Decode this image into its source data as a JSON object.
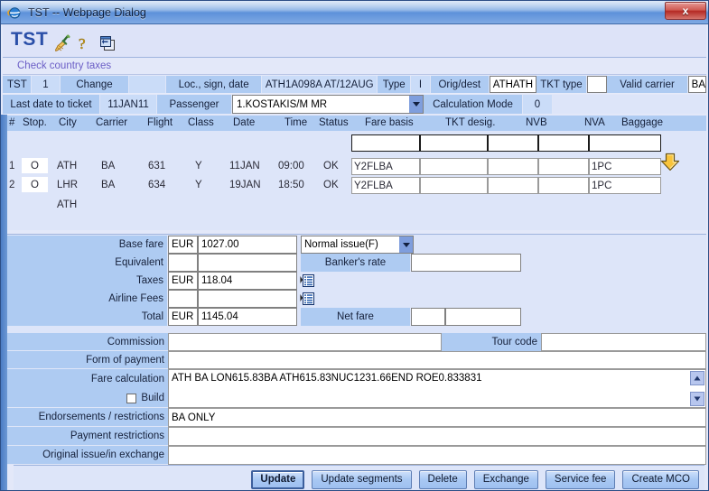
{
  "window": {
    "title": "TST -- Webpage Dialog",
    "close_label": "x",
    "icon": "ie-icon"
  },
  "app": {
    "logo": "TST",
    "toolbar_icons": [
      "broom-icon",
      "help-question-icon",
      "copy-window-icon"
    ],
    "link_check_country_taxes": "Check country taxes"
  },
  "header_row1": {
    "tst_label": "TST",
    "tst_value": "1",
    "change_label": "Change",
    "change_value": "",
    "loc_sign_date_label": "Loc., sign, date",
    "loc_sign_date_value": "ATH1A098A AT/12AUG",
    "type_label": "Type",
    "type_value": "I",
    "orig_dest_label": "Orig/dest",
    "orig_dest_value": "ATHATH",
    "tkt_type_label": "TKT type",
    "tkt_type_value": "",
    "valid_carrier_label": "Valid carrier",
    "valid_carrier_value": "BA"
  },
  "header_row2": {
    "last_date_label": "Last date to ticket",
    "last_date_value": "11JAN11",
    "passenger_label": "Passenger",
    "passenger_value": "1.KOSTAKIS/M MR",
    "calculation_mode_label": "Calculation Mode",
    "calculation_mode_value": "0"
  },
  "segments": {
    "columns": [
      "#",
      "Stop.",
      "City",
      "Carrier",
      "Flight",
      "Class",
      "Date",
      "Time",
      "Status",
      "Fare basis",
      "TKT desig.",
      "NVB",
      "NVA",
      "Baggage"
    ],
    "blank_row": {
      "fare_basis": "",
      "tkt_desig": "",
      "nvb": "",
      "nva": "",
      "baggage": ""
    },
    "rows": [
      {
        "num": "1",
        "stop": "O",
        "city": "ATH",
        "carrier": "BA",
        "flight": "631",
        "class": "Y",
        "date": "11JAN",
        "time": "09:00",
        "status": "OK",
        "fare_basis": "Y2FLBA",
        "tkt_desig": "",
        "nvb": "",
        "nva": "",
        "baggage": "1PC"
      },
      {
        "num": "2",
        "stop": "O",
        "city": "LHR",
        "carrier": "BA",
        "flight": "634",
        "class": "Y",
        "date": "19JAN",
        "time": "18:50",
        "status": "OK",
        "fare_basis": "Y2FLBA",
        "tkt_desig": "",
        "nvb": "",
        "nva": "",
        "baggage": "1PC"
      }
    ],
    "final_city": "ATH",
    "arrow_icon": "yellow-down-arrow-icon"
  },
  "fare": {
    "base_fare_label": "Base fare",
    "base_fare_currency": "EUR",
    "base_fare_value": "1027.00",
    "issue_type_value": "Normal issue(F)",
    "equivalent_label": "Equivalent",
    "equivalent_currency": "",
    "equivalent_value": "",
    "bankers_rate_label": "Banker's rate",
    "bankers_rate_value": "",
    "taxes_label": "Taxes",
    "taxes_currency": "EUR",
    "taxes_value": "118.04",
    "airline_fees_label": "Airline Fees",
    "airline_fees_currency": "",
    "airline_fees_value": "",
    "total_label": "Total",
    "total_currency": "EUR",
    "total_value": "1145.04",
    "net_fare_label": "Net fare",
    "net_fare_currency": "",
    "net_fare_value": ""
  },
  "lower": {
    "commission_label": "Commission",
    "commission_value": "",
    "tour_code_label": "Tour code",
    "tour_code_value": "",
    "form_of_payment_label": "Form of payment",
    "form_of_payment_value": "",
    "fare_calculation_label": "Fare calculation",
    "fare_calculation_value": "ATH BA LON615.83BA ATH615.83NUC1231.66END ROE0.833831",
    "build_label": "Build",
    "build_checked": false,
    "endorsements_label": "Endorsements / restrictions",
    "endorsements_value": "BA ONLY",
    "payment_restrictions_label": "Payment restrictions",
    "payment_restrictions_value": "",
    "original_issue_label": "Original issue/in exchange",
    "original_issue_value": ""
  },
  "buttons": [
    {
      "id": "update",
      "label": "Update",
      "default": true
    },
    {
      "id": "update-segments",
      "label": "Update segments",
      "default": false
    },
    {
      "id": "delete",
      "label": "Delete",
      "default": false
    },
    {
      "id": "exchange",
      "label": "Exchange",
      "default": false
    },
    {
      "id": "service-fee",
      "label": "Service fee",
      "default": false
    },
    {
      "id": "create-mco",
      "label": "Create MCO",
      "default": false
    }
  ],
  "colors": {
    "label_blue": "#aecbf2",
    "label_blue_light": "#cadcf8",
    "panel_bg": "#dde5f9",
    "page_bg": "#e3e8f9",
    "accent_link": "#6b5ec6",
    "logo_blue": "#2a4fa8",
    "arrow_yellow": "#f5b217"
  }
}
